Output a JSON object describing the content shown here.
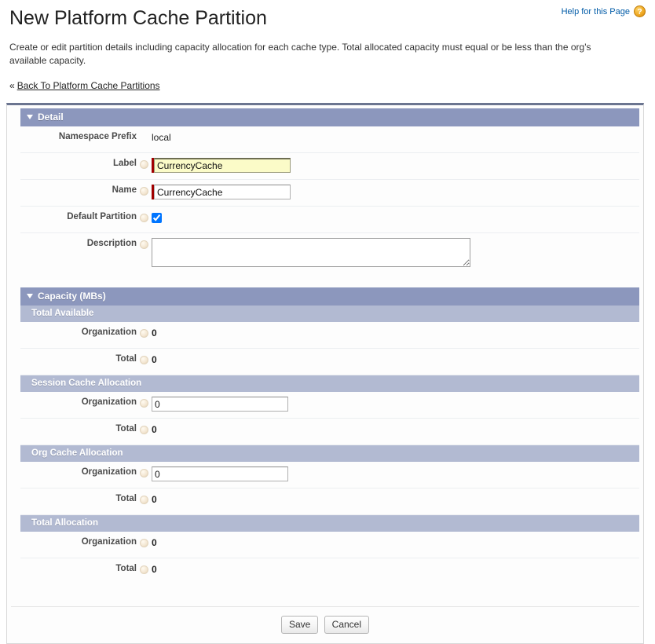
{
  "header": {
    "title": "New Platform Cache Partition",
    "help_label": "Help for this Page",
    "help_icon": "question-mark-icon",
    "description": "Create or edit partition details including capacity allocation for each cache type. Total allocated capacity must equal or be less than the org's available capacity.",
    "back_link": "Back To Platform Cache Partitions",
    "back_guillemet": "«"
  },
  "detail": {
    "section_title": "Detail",
    "namespace_prefix": {
      "label": "Namespace Prefix",
      "value": "local"
    },
    "label_field": {
      "label": "Label",
      "value": "CurrencyCache",
      "required": true
    },
    "name_field": {
      "label": "Name",
      "value": "CurrencyCache",
      "required": true
    },
    "default_partition": {
      "label": "Default Partition",
      "checked": true
    },
    "description_field": {
      "label": "Description",
      "value": ""
    }
  },
  "capacity": {
    "section_title": "Capacity (MBs)",
    "groups": [
      {
        "title": "Total Available",
        "rows": [
          {
            "label": "Organization",
            "value": "0",
            "editable": false
          },
          {
            "label": "Total",
            "value": "0",
            "editable": false
          }
        ]
      },
      {
        "title": "Session Cache Allocation",
        "rows": [
          {
            "label": "Organization",
            "value": "0",
            "editable": true
          },
          {
            "label": "Total",
            "value": "0",
            "editable": false
          }
        ]
      },
      {
        "title": "Org Cache Allocation",
        "rows": [
          {
            "label": "Organization",
            "value": "0",
            "editable": true
          },
          {
            "label": "Total",
            "value": "0",
            "editable": false
          }
        ]
      },
      {
        "title": "Total Allocation",
        "rows": [
          {
            "label": "Organization",
            "value": "0",
            "editable": false
          },
          {
            "label": "Total",
            "value": "0",
            "editable": false
          }
        ]
      }
    ]
  },
  "footer": {
    "save_label": "Save",
    "cancel_label": "Cancel"
  },
  "colors": {
    "section_header": "#8c97bd",
    "sub_header": "#b2bad2",
    "required_bar": "#a00000",
    "highlight_field": "#fbfbc8",
    "link": "#015ba7"
  }
}
